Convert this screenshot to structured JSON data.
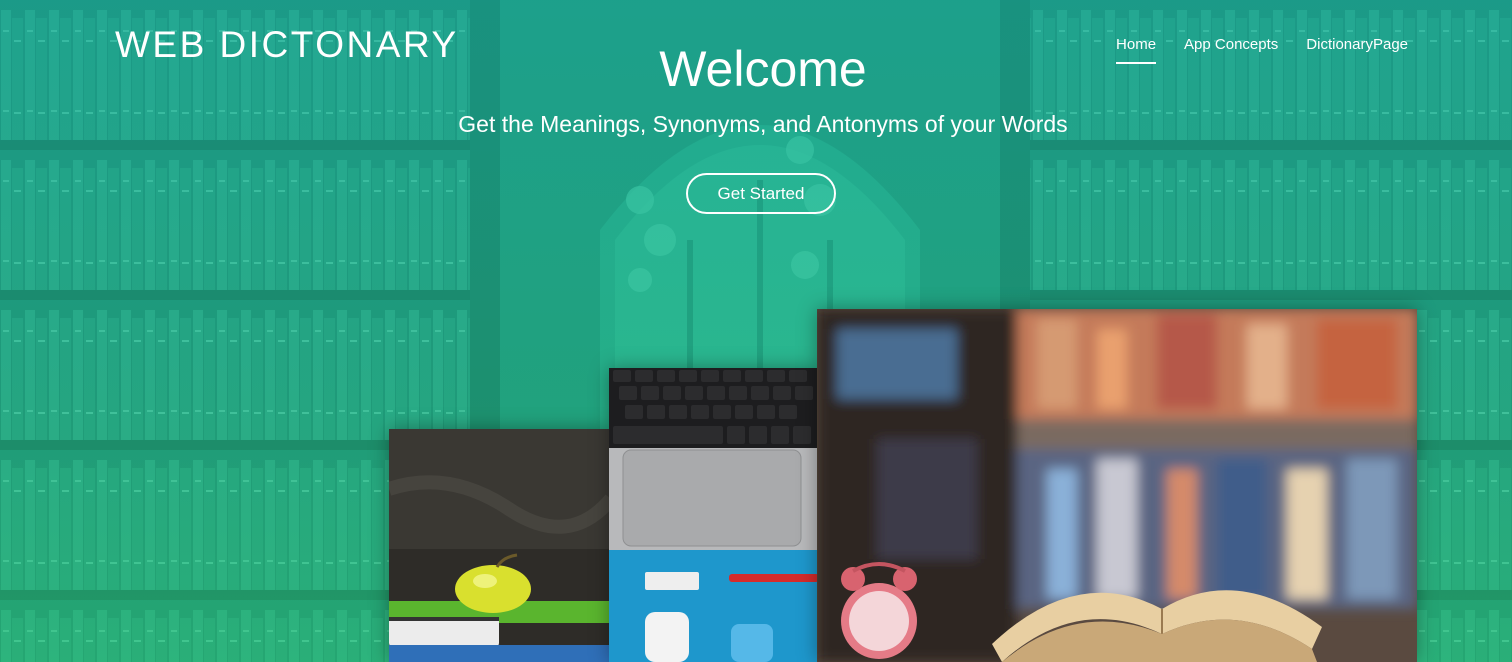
{
  "header": {
    "brand": "WEB DICTONARY",
    "nav": [
      {
        "label": "Home",
        "active": true
      },
      {
        "label": "App Concepts",
        "active": false
      },
      {
        "label": "DictionaryPage",
        "active": false
      }
    ]
  },
  "hero": {
    "title": "Welcome",
    "subtitle": "Get the Meanings, Synonyms, and Antonyms of your Words",
    "cta_label": "Get Started"
  },
  "images": [
    {
      "name": "apple-books-photo",
      "icon": "apple-on-books-image"
    },
    {
      "name": "laptop-desk-photo",
      "icon": "laptop-keyboard-image"
    },
    {
      "name": "library-photo",
      "icon": "open-book-alarm-clock-image"
    }
  ],
  "colors": {
    "overlay_teal": "#1fb59a",
    "overlay_green": "#30c878",
    "text": "#ffffff"
  }
}
